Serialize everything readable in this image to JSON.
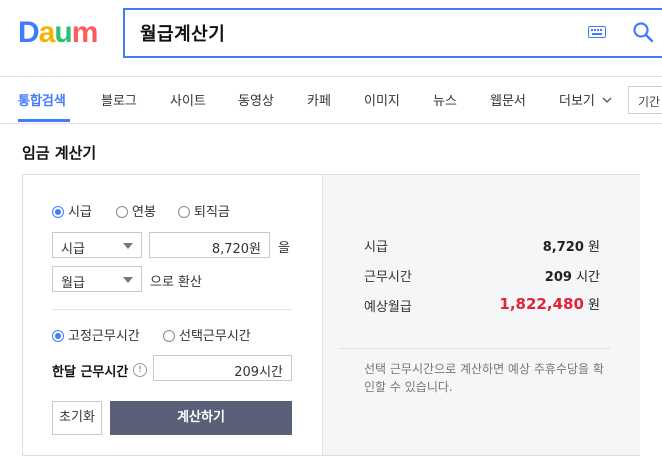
{
  "logo": {
    "letters": [
      "D",
      "a",
      "u",
      "m"
    ],
    "colors": [
      "#3f7cff",
      "#f4b400",
      "#2fbf71",
      "#ff5b5b"
    ]
  },
  "search": {
    "query": "월급계산기"
  },
  "tabs": [
    "통합검색",
    "블로그",
    "사이트",
    "동영상",
    "카페",
    "이미지",
    "뉴스",
    "웹문서",
    "더보기"
  ],
  "period_label": "기간",
  "widget": {
    "title": "임금 계산기",
    "wage_types": [
      "시급",
      "연봉",
      "퇴직금"
    ],
    "selected_wage_type": "시급",
    "unit_select": "시급",
    "amount": "8,720원",
    "amount_suffix": "을",
    "convert_select": "월급",
    "convert_suffix": "으로 환산",
    "hour_types": [
      "고정근무시간",
      "선택근무시간"
    ],
    "selected_hour_type": "고정근무시간",
    "hours_label": "한달 근무시간",
    "hours_value": "209시간",
    "reset_label": "초기화",
    "calc_label": "계산하기"
  },
  "results": {
    "rows": [
      {
        "label": "시급",
        "value": "8,720",
        "unit": "원"
      },
      {
        "label": "근무시간",
        "value": "209",
        "unit": "시간"
      },
      {
        "label": "예상월급",
        "value": "1,822,480",
        "unit": "원"
      }
    ],
    "note": "선택 근무시간으로 계산하면 예상 주휴수당을 확인할 수 있습니다."
  },
  "accent_color": "#3f7cff",
  "highlight_color": "#e0243a"
}
